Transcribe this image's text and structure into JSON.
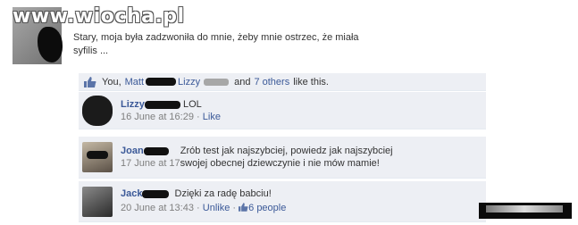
{
  "watermark": "www.wiocha.pl",
  "post": {
    "text_line1": "Stary, moja była zadzwoniła do mnie, żeby mnie ostrzec, że miała",
    "text_line2": "syfilis ..."
  },
  "likes": {
    "you": "You,",
    "matt": "Matt",
    "lizzy": "Lizzy",
    "and": "and",
    "others": "7 others",
    "suffix": "like this."
  },
  "comments": [
    {
      "name": "Lizzy",
      "text": "LOL",
      "time": "16 June at 16:29",
      "sep": "·",
      "action": "Like"
    },
    {
      "name": "Joan",
      "text_line1": "Zrób test jak najszybciej, powiedz jak najszybciej",
      "time": "17 June at 17",
      "text_line2": "swojej obecnej dziewczynie i nie mów mamie!"
    },
    {
      "name": "Jack",
      "text": "Dzięki za radę babciu!",
      "time": "20 June at 13:43",
      "sep": "·",
      "action": "Unlike",
      "sep2": "·",
      "likes": "6 people"
    }
  ],
  "colors": {
    "link": "#3b5998",
    "panel": "#edeff4",
    "meta": "#7f7f7f"
  }
}
